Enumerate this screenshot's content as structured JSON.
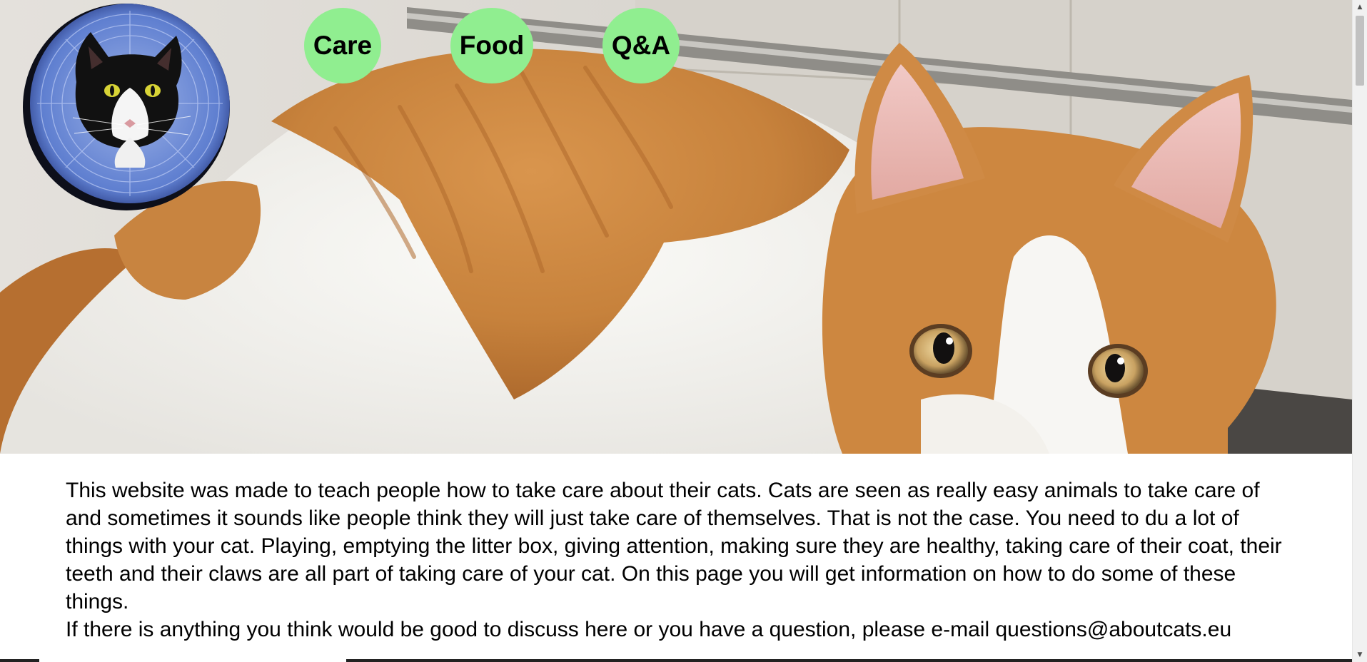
{
  "nav": {
    "items": [
      {
        "label": "Care"
      },
      {
        "label": "Food"
      },
      {
        "label": "Q&A"
      }
    ],
    "button_color": "#90ee90"
  },
  "hero": {
    "image": "ginger-and-white-cat-photo"
  },
  "logo": {
    "image": "black-and-white-cat-with-cone-logo"
  },
  "content": {
    "paragraph1": "This website was made to teach people how to take care about their cats. Cats are seen as really easy animals to take care of and sometimes it sounds like people think they will just take care of themselves. That is not the case. You need to du a lot of things with your cat. Playing, emptying the litter box, giving attention, making sure they are healthy, taking care of their coat, their teeth and their claws are all part of taking care of your cat. On this page you will get information on how to do some of these things.",
    "paragraph2": "If there is anything you think would be good to discuss here or you have a question, please e-mail questions@aboutcats.eu"
  },
  "scrollbar": {
    "up_icon": "▲",
    "down_icon": "▼"
  }
}
